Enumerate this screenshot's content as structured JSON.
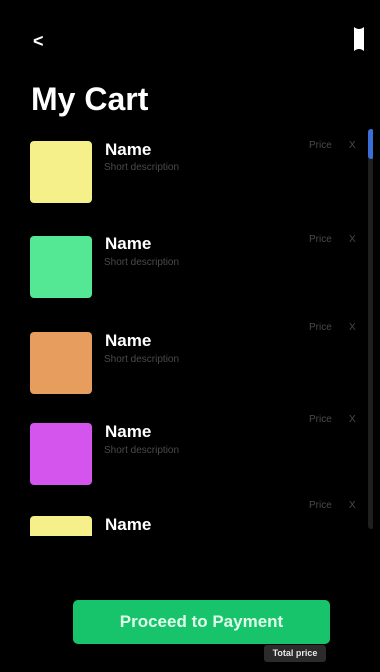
{
  "header": {
    "back_label": "<",
    "title": "My Cart",
    "bookmark_icon": "bookmark-icon"
  },
  "cart": {
    "items": [
      {
        "name": "Name",
        "description": "Short description",
        "price": "Price",
        "remove": "X",
        "color": "#f6f08a"
      },
      {
        "name": "Name",
        "description": "Short description",
        "price": "Price",
        "remove": "X",
        "color": "#55e894"
      },
      {
        "name": "Name",
        "description": "Short description",
        "price": "Price",
        "remove": "X",
        "color": "#e69d5d"
      },
      {
        "name": "Name",
        "description": "Short description",
        "price": "Price",
        "remove": "X",
        "color": "#d455ee"
      },
      {
        "name": "Name",
        "description": "",
        "price": "Price",
        "remove": "X",
        "color": "#f6f08a"
      }
    ]
  },
  "footer": {
    "proceed_label": "Proceed to Payment",
    "total_label": "Total price"
  },
  "colors": {
    "background": "#000000",
    "accent_green": "#18c46b",
    "scroll_thumb": "#3a6fd8",
    "muted_text": "#4a4a4a"
  }
}
